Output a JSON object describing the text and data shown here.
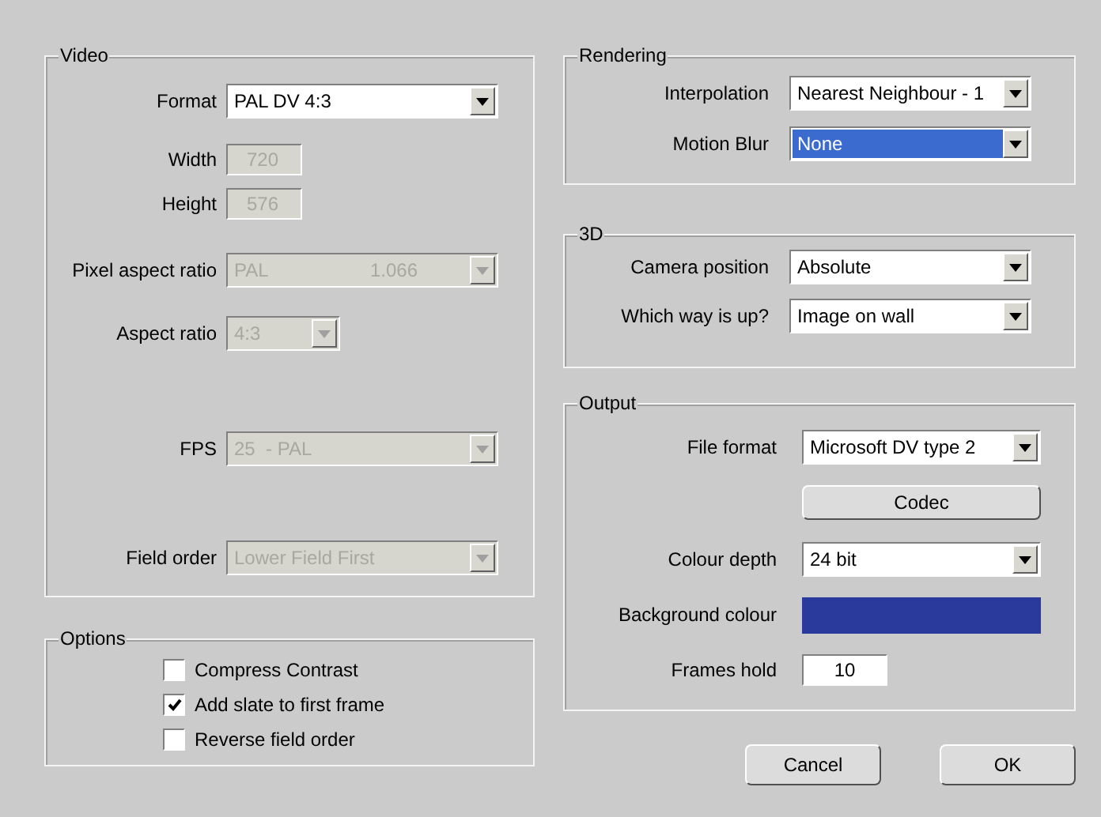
{
  "video": {
    "title": "Video",
    "fields": [
      {
        "label": "Format",
        "kind": "select",
        "value": "PAL DV 4:3",
        "disabled": false
      },
      {
        "label": "Width",
        "kind": "number",
        "value": "720",
        "disabled": true
      },
      {
        "label": "Height",
        "kind": "number",
        "value": "576",
        "disabled": true
      },
      {
        "label": "Pixel aspect ratio",
        "kind": "select",
        "value": "PAL",
        "extra": "1.066",
        "disabled": true
      },
      {
        "label": "Aspect ratio",
        "kind": "short-select",
        "value": "4:3",
        "disabled": true
      },
      {
        "label": "FPS",
        "kind": "select",
        "value": "25  - PAL",
        "disabled": true
      },
      {
        "label": "Field order",
        "kind": "select",
        "value": "Lower Field First",
        "disabled": true
      }
    ]
  },
  "options": {
    "title": "Options",
    "items": [
      {
        "label": "Compress Contrast",
        "checked": false
      },
      {
        "label": "Add slate to first frame",
        "checked": true
      },
      {
        "label": "Reverse field order",
        "checked": false
      }
    ]
  },
  "rendering": {
    "title": "Rendering",
    "fields": [
      {
        "label": "Interpolation",
        "kind": "select",
        "value": "Nearest Neighbour - 1",
        "highlighted": false
      },
      {
        "label": "Motion Blur",
        "kind": "select",
        "value": "None",
        "highlighted": true
      }
    ]
  },
  "three_d": {
    "title": "3D",
    "fields": [
      {
        "label": "Camera position",
        "kind": "select",
        "value": "Absolute",
        "highlighted": false
      },
      {
        "label": "Which way is up?",
        "kind": "select",
        "value": "Image on wall",
        "highlighted": false
      }
    ]
  },
  "output": {
    "title": "Output",
    "fields": [
      {
        "label": "File format",
        "kind": "select",
        "value": "Microsoft DV type 2"
      },
      {
        "kind": "button",
        "value": "Codec"
      },
      {
        "label": "Colour depth",
        "kind": "select",
        "value": "24 bit"
      },
      {
        "label": "Background colour",
        "kind": "swatch",
        "color": "#2a3a9c"
      },
      {
        "label": "Frames hold",
        "kind": "number",
        "value": "10"
      }
    ]
  },
  "buttons": [
    "Cancel",
    "OK"
  ]
}
